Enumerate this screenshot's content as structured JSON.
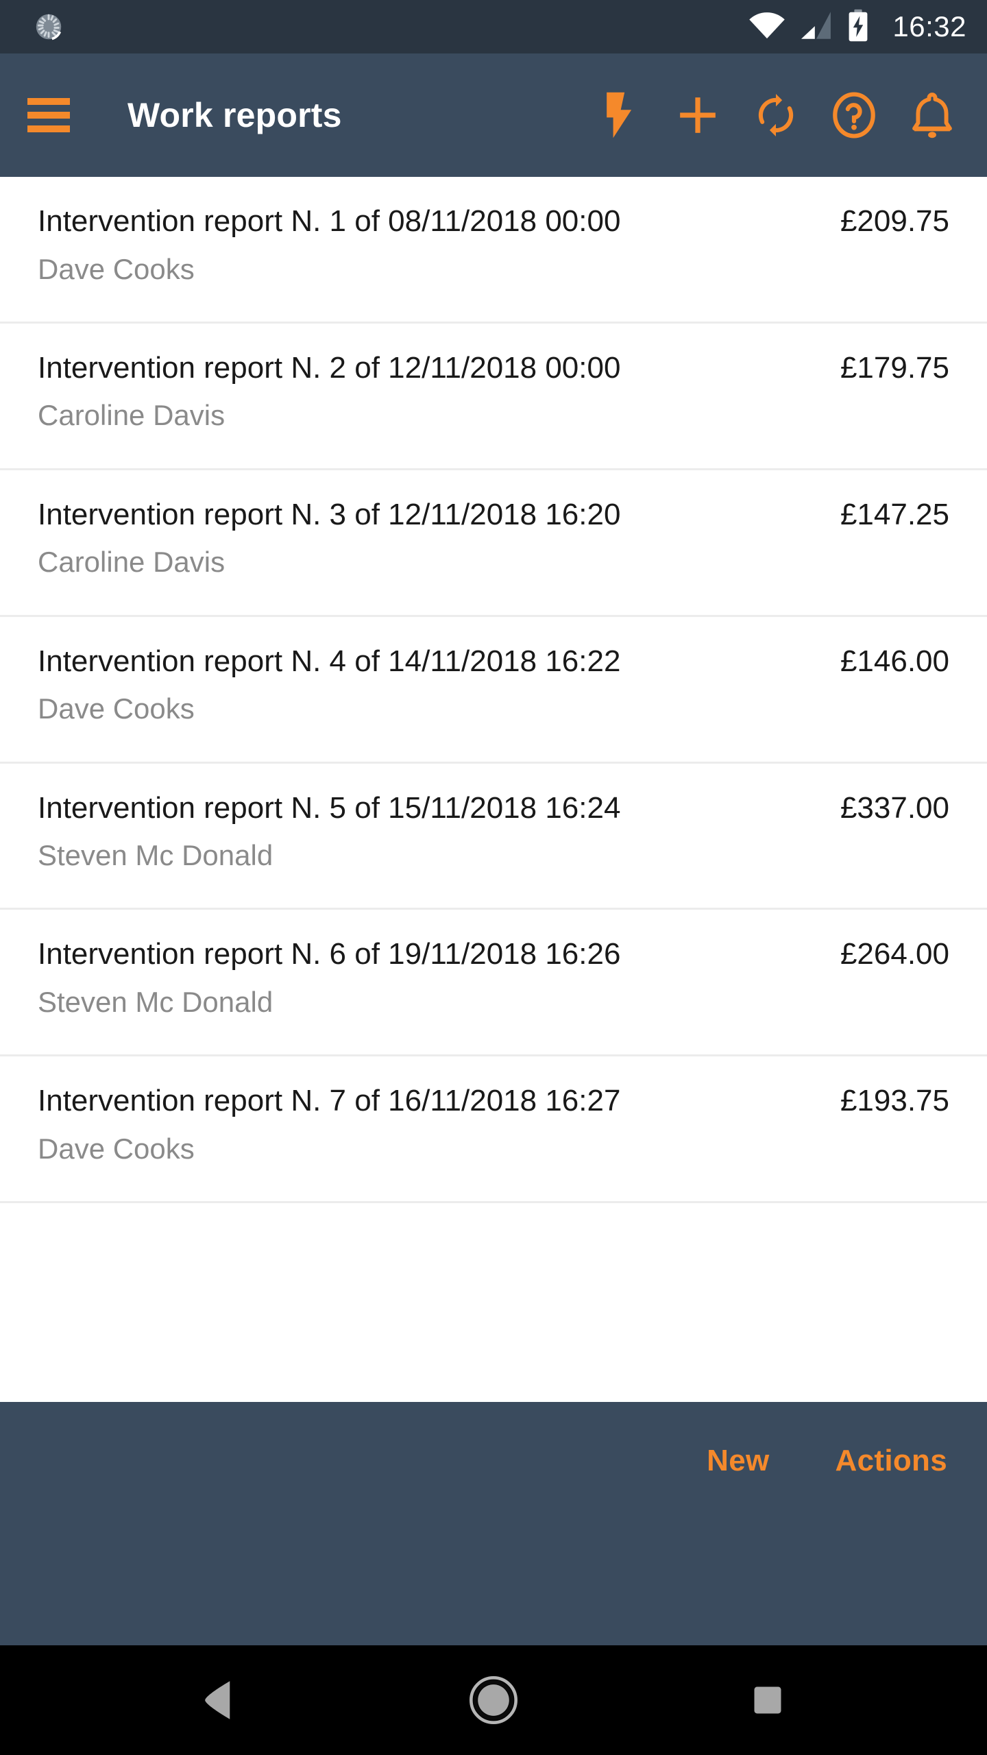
{
  "status_bar": {
    "spinner_icon": "progress-spinner-icon",
    "wifi_icon": "wifi-icon",
    "signal_icon": "cell-signal-icon",
    "battery_icon": "battery-charging-icon",
    "time": "16:32"
  },
  "app_bar": {
    "menu_icon": "hamburger-menu-icon",
    "title": "Work reports",
    "actions": [
      {
        "name": "lightning-bolt-icon",
        "label": "Quick action"
      },
      {
        "name": "plus-icon",
        "label": "Add"
      },
      {
        "name": "sync-icon",
        "label": "Sync"
      },
      {
        "name": "help-circle-icon",
        "label": "Help"
      },
      {
        "name": "bell-icon",
        "label": "Notifications"
      }
    ]
  },
  "list": {
    "rows": [
      {
        "title": "Intervention report N. 1 of 08/11/2018 00:00",
        "amount": "£209.75",
        "subtitle": "Dave Cooks"
      },
      {
        "title": "Intervention report N. 2 of 12/11/2018 00:00",
        "amount": "£179.75",
        "subtitle": "Caroline Davis"
      },
      {
        "title": "Intervention report N. 3 of 12/11/2018 16:20",
        "amount": "£147.25",
        "subtitle": "Caroline Davis"
      },
      {
        "title": "Intervention report N. 4 of 14/11/2018 16:22",
        "amount": "£146.00",
        "subtitle": "Dave Cooks"
      },
      {
        "title": "Intervention report N. 5 of 15/11/2018 16:24",
        "amount": "£337.00",
        "subtitle": "Steven Mc Donald"
      },
      {
        "title": "Intervention report N. 6 of 19/11/2018 16:26",
        "amount": "£264.00",
        "subtitle": "Steven Mc Donald"
      },
      {
        "title": "Intervention report N. 7 of 16/11/2018 16:27",
        "amount": "£193.75",
        "subtitle": "Dave Cooks"
      }
    ]
  },
  "bottom_bar": {
    "new_label": "New",
    "actions_label": "Actions"
  },
  "nav_bar": {
    "back_icon": "back-triangle-icon",
    "home_icon": "home-circle-icon",
    "recents_icon": "recents-square-icon"
  },
  "colors": {
    "status_bar_bg": "#2a3541",
    "app_bar_bg": "#3a4b5e",
    "accent_orange": "#f5892b",
    "list_bg": "#ffffff",
    "divider": "#ececec",
    "title_text": "#191919",
    "subtitle_text": "#8a8a8a",
    "nav_bar_bg": "#000000"
  }
}
